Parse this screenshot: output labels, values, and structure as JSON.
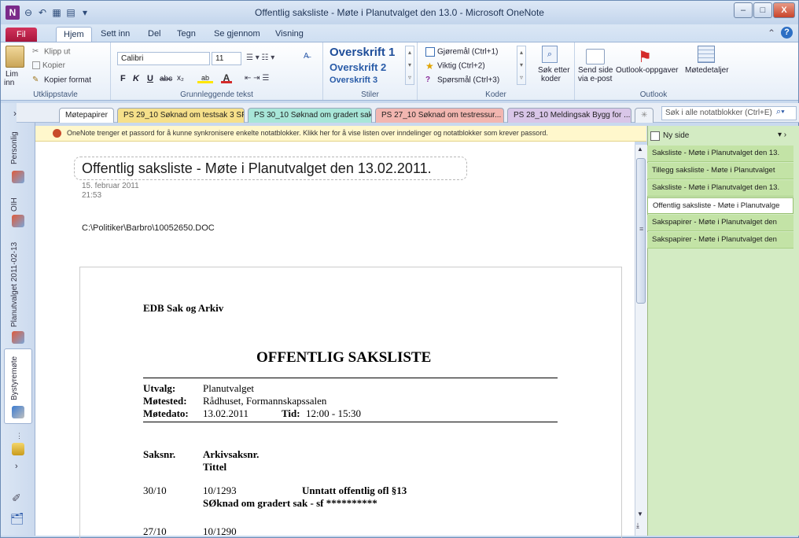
{
  "window": {
    "title": "Offentlig saksliste - Møte i Planutvalget den 13.0  -  Microsoft OneNote",
    "controls": [
      "–",
      "□",
      "X"
    ]
  },
  "ribbon_tabs": [
    "Fil",
    "Hjem",
    "Sett inn",
    "Del",
    "Tegn",
    "Se gjennom",
    "Visning"
  ],
  "clipboard": {
    "paste": "Lim",
    "paste2": "inn",
    "cut": "Klipp ut",
    "copy": "Kopier",
    "format_painter": "Kopier format",
    "label": "Utklippstavle"
  },
  "basic_text": {
    "font": "Calibri",
    "size": "11",
    "label": "Grunnleggende tekst",
    "bold": "F",
    "italic": "K",
    "underline": "U",
    "strike": "abc",
    "sub": "x₂"
  },
  "styles": {
    "h1": "Overskrift 1",
    "h2": "Overskrift 2",
    "h3": "Overskrift 3",
    "label": "Stiler"
  },
  "tags": {
    "todo": "Gjøremål (Ctrl+1)",
    "important": "Viktig (Ctrl+2)",
    "question": "Spørsmål (Ctrl+3)",
    "find": "Søk etter",
    "find2": "koder",
    "label": "Koder"
  },
  "outlook": {
    "send": "Send side",
    "send2": "via e-post",
    "tasks": "Outlook-oppgaver",
    "meeting": "Møtedetaljer",
    "label": "Outlook"
  },
  "section_tabs": [
    {
      "label": "Møtepapirer",
      "color": "#ffffff"
    },
    {
      "label": "PS 29_10 Søknad om testsak 3 SF",
      "color": "#f6e08a"
    },
    {
      "label": "PS 30_10 Søknad om gradert sak",
      "color": "#a8e6d8"
    },
    {
      "label": "PS 27_10 Søknad om testressur...",
      "color": "#f2b6b0"
    },
    {
      "label": "PS 28_10 Meldingsak Bygg for ...",
      "color": "#d9c6e8"
    }
  ],
  "search_placeholder": "Søk i alle notatblokker (Ctrl+E)",
  "notebooks": [
    "Personlig",
    "OIH",
    "Planutvalget 2011-02-13",
    "Bystyremøte"
  ],
  "info_bar": "OneNote trenger et passord for å kunne synkronisere enkelte notatblokker. Klikk her for å vise listen over inndelinger og notatblokker som krever passord.",
  "page": {
    "title": "Offentlig saksliste - Møte i Planutvalget den 13.02.2011.",
    "date": "15. februar 2011",
    "time": "21:53",
    "path": "C:\\Politiker\\Barbro\\10052650.DOC"
  },
  "document": {
    "org": "EDB Sak og Arkiv",
    "heading": "OFFENTLIG SAKSLISTE",
    "utvalg_label": "Utvalg:",
    "utvalg": "Planutvalget",
    "motested_label": "Møtested:",
    "motested": "Rådhuset, Formannskapssalen",
    "motedato_label": "Møtedato:",
    "motedato": "13.02.2011",
    "tid_label": "Tid:",
    "tid": "12:00 - 15:30",
    "col_saksnr": "Saksnr.",
    "col_arkiv": "Arkivsaksnr.",
    "col_tittel": "Tittel",
    "rows": [
      {
        "saksnr": "30/10",
        "arkiv": "10/1293",
        "note": "Unntatt offentlig ofl §13",
        "title": "SØknad om gradert sak - sf **********"
      },
      {
        "saksnr": "27/10",
        "arkiv": "10/1290",
        "note": "",
        "title": ""
      }
    ]
  },
  "pages_panel": {
    "new_page": "Ny side",
    "pages": [
      "Saksliste - Møte i Planutvalget den 13.",
      "Tillegg saksliste - Møte i Planutvalget",
      "Saksliste - Møte i Planutvalget den 13.",
      "Offentlig saksliste - Møte i Planutvalge",
      "Sakspapirer - Møte i Planutvalget den",
      "Sakspapirer - Møte i Planutvalget den"
    ],
    "selected_index": 3
  }
}
